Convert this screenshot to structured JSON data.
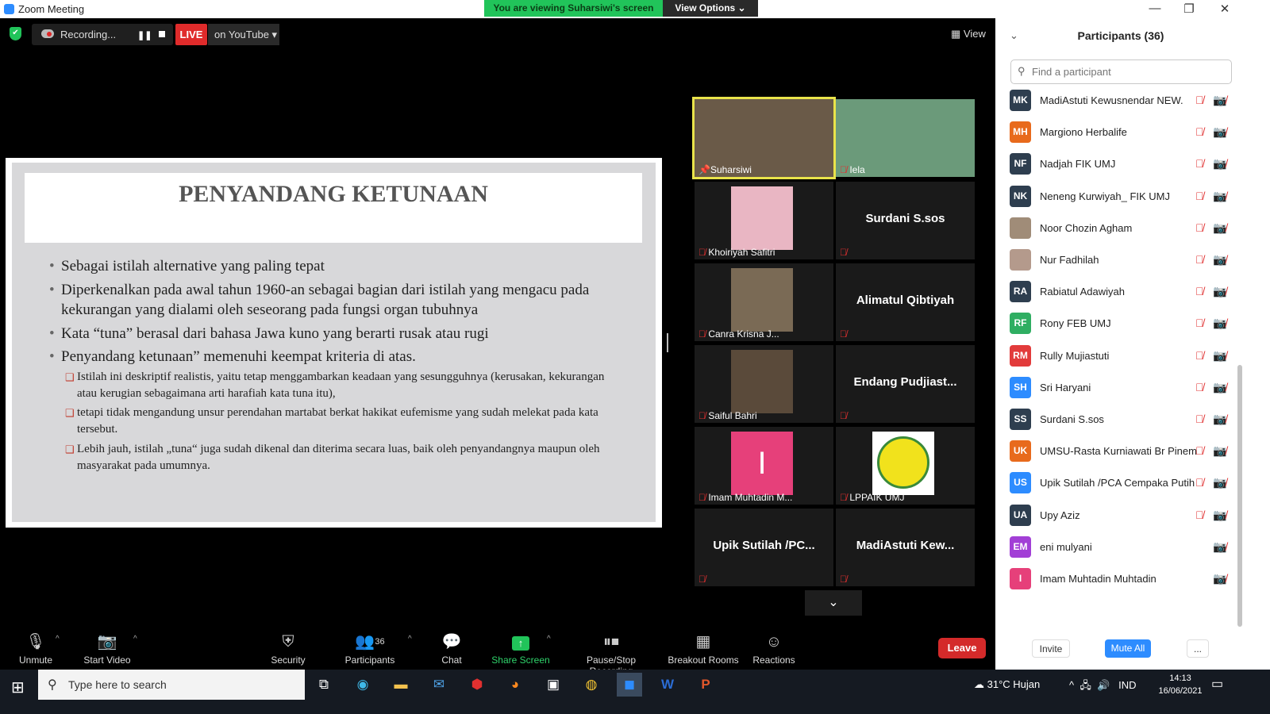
{
  "window": {
    "title": "Zoom Meeting"
  },
  "share_banner": {
    "viewing": "You are viewing Suharsiwi's screen",
    "view_options": "View Options ⌄"
  },
  "recording": {
    "label": "Recording...",
    "live": "LIVE",
    "platform": "on YouTube ▾"
  },
  "view_label": "View",
  "slide": {
    "title": "PENYANDANG KETUNAAN",
    "bullets": [
      "Sebagai istilah alternative yang paling tepat",
      "Diperkenalkan pada awal tahun 1960-an sebagai bagian dari istilah yang mengacu pada kekurangan yang dialami oleh seseorang pada fungsi organ tubuhnya",
      "Kata “tuna” berasal dari bahasa Jawa kuno yang berarti rusak atau rugi",
      "Penyandang ketunaan” memenuhi keempat kriteria di atas."
    ],
    "subbullets": [
      "Istilah ini deskriptif realistis, yaitu tetap menggambarkan keadaan yang sesungguhnya (kerusakan, kekurangan atau kerugian sebagaimana arti harafiah kata tuna itu),",
      "tetapi tidak mengandung unsur perendahan martabat berkat hakikat eufemisme yang sudah melekat pada kata tersebut.",
      "Lebih jauh, istilah „tuna“ juga sudah dikenal dan diterima secara luas, baik oleh penyandangnya maupun oleh masyarakat pada umumnya."
    ]
  },
  "video_tiles": [
    {
      "name": "Suharsiwi",
      "type": "photo",
      "color": "#6a5a48"
    },
    {
      "name": "Iela",
      "type": "photo",
      "color": "#6b9a7a"
    },
    {
      "name": "Khoiriyah Safitri",
      "type": "photo",
      "color": "#e9b6c3"
    },
    {
      "name": "",
      "display": "Surdani S.sos",
      "type": "name"
    },
    {
      "name": "Canra Krisna J...",
      "type": "photo",
      "color": "#7a6a55"
    },
    {
      "name": "",
      "display": "Alimatul Qibtiyah",
      "type": "name"
    },
    {
      "name": "Saiful Bahri",
      "type": "photo",
      "color": "#5a4a3a"
    },
    {
      "name": "",
      "display": "Endang Pudjiast...",
      "type": "name"
    },
    {
      "name": "Imam Muhtadin M...",
      "type": "initial",
      "initial": "I",
      "color": "#e6407a"
    },
    {
      "name": "LPPAIK UMJ",
      "type": "logo",
      "color": "#f1e21c"
    },
    {
      "name": "",
      "display": "Upik Sutilah /PC...",
      "type": "name"
    },
    {
      "name": "",
      "display": "MadiAstuti Kew...",
      "type": "name"
    }
  ],
  "toolbar": {
    "unmute": "Unmute",
    "start_video": "Start Video",
    "security": "Security",
    "participants": "Participants",
    "participants_count": "36",
    "chat": "Chat",
    "share_screen": "Share Screen",
    "pause_recording": "Pause/Stop Recording",
    "breakout": "Breakout Rooms",
    "reactions": "Reactions",
    "leave": "Leave"
  },
  "participants_panel": {
    "title": "Participants (36)",
    "search_placeholder": "Find a participant",
    "invite": "Invite",
    "mute_all": "Mute All",
    "more": "...",
    "list": [
      {
        "initials": "MK",
        "name": "MadiAstuti Kewusnendar NEW.",
        "color": "#2e3e4f",
        "mic": true
      },
      {
        "initials": "MH",
        "name": "Margiono Herbalife",
        "color": "#e86a1c",
        "mic": true
      },
      {
        "initials": "NF",
        "name": "Nadjah FIK UMJ",
        "color": "#2e3e4f",
        "mic": true
      },
      {
        "initials": "NK",
        "name": "Neneng Kurwiyah_ FIK UMJ",
        "color": "#2e3e4f",
        "mic": true
      },
      {
        "initials": "",
        "name": "Noor Chozin Agham",
        "color": "#a08c78",
        "mic": true
      },
      {
        "initials": "",
        "name": "Nur Fadhilah",
        "color": "#b49a8c",
        "mic": true
      },
      {
        "initials": "RA",
        "name": "Rabiatul Adawiyah",
        "color": "#2e3e4f",
        "mic": true
      },
      {
        "initials": "RF",
        "name": "Rony FEB UMJ",
        "color": "#2fae62",
        "mic": true
      },
      {
        "initials": "RM",
        "name": "Rully Mujiastuti",
        "color": "#e23b3b",
        "mic": true
      },
      {
        "initials": "SH",
        "name": "Sri Haryani",
        "color": "#2d8cff",
        "mic": true
      },
      {
        "initials": "SS",
        "name": "Surdani S.sos",
        "color": "#2e3e4f",
        "mic": true
      },
      {
        "initials": "UK",
        "name": "UMSU-Rasta Kurniawati Br Pinem",
        "color": "#e86a1c",
        "mic": true
      },
      {
        "initials": "US",
        "name": "Upik Sutilah /PCA Cempaka Putih",
        "color": "#2d8cff",
        "mic": true
      },
      {
        "initials": "UA",
        "name": "Upy Aziz",
        "color": "#2e3e4f",
        "mic": true
      },
      {
        "initials": "EM",
        "name": "eni mulyani",
        "color": "#a23fd6",
        "mic": false
      },
      {
        "initials": "I",
        "name": "Imam Muhtadin Muhtadin",
        "color": "#e6407a",
        "mic": false
      }
    ]
  },
  "taskbar": {
    "search_placeholder": "Type here to search",
    "weather": "31°C  Hujan",
    "lang": "IND",
    "time": "14:13",
    "date": "16/06/2021"
  }
}
